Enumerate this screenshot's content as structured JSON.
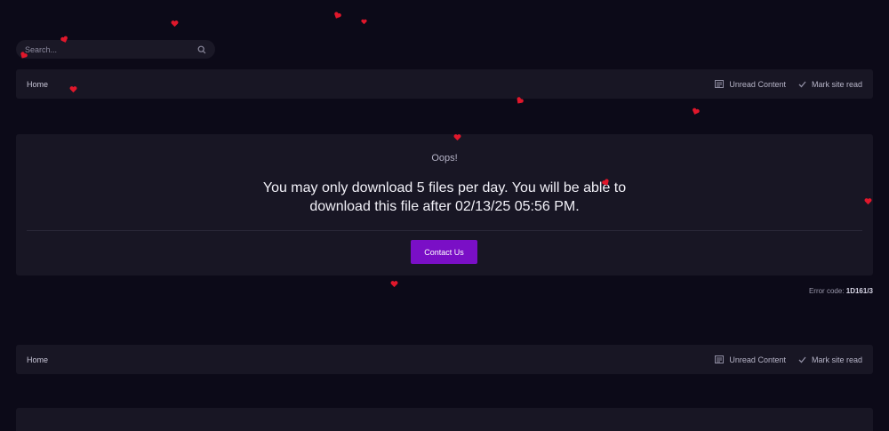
{
  "search": {
    "placeholder": "Search..."
  },
  "nav_top": {
    "home": "Home",
    "unread": "Unread Content",
    "mark_read": "Mark site read"
  },
  "error": {
    "heading": "Oops!",
    "message_line1": "You may only download 5 files per day. You will be able to",
    "message_line2": "download this file after 02/13/25 05:56 PM.",
    "contact_label": "Contact Us",
    "code_label": "Error code:",
    "code_value": "1D161/3"
  },
  "nav_bottom": {
    "home": "Home",
    "unread": "Unread Content",
    "mark_read": "Mark site read"
  },
  "colors": {
    "background": "#0c0a18",
    "panel": "#181624",
    "accent": "#7a0fc6",
    "heart": "#e0172b"
  },
  "icons": [
    "search-icon",
    "newspaper-icon",
    "check-icon",
    "heart-icon"
  ]
}
